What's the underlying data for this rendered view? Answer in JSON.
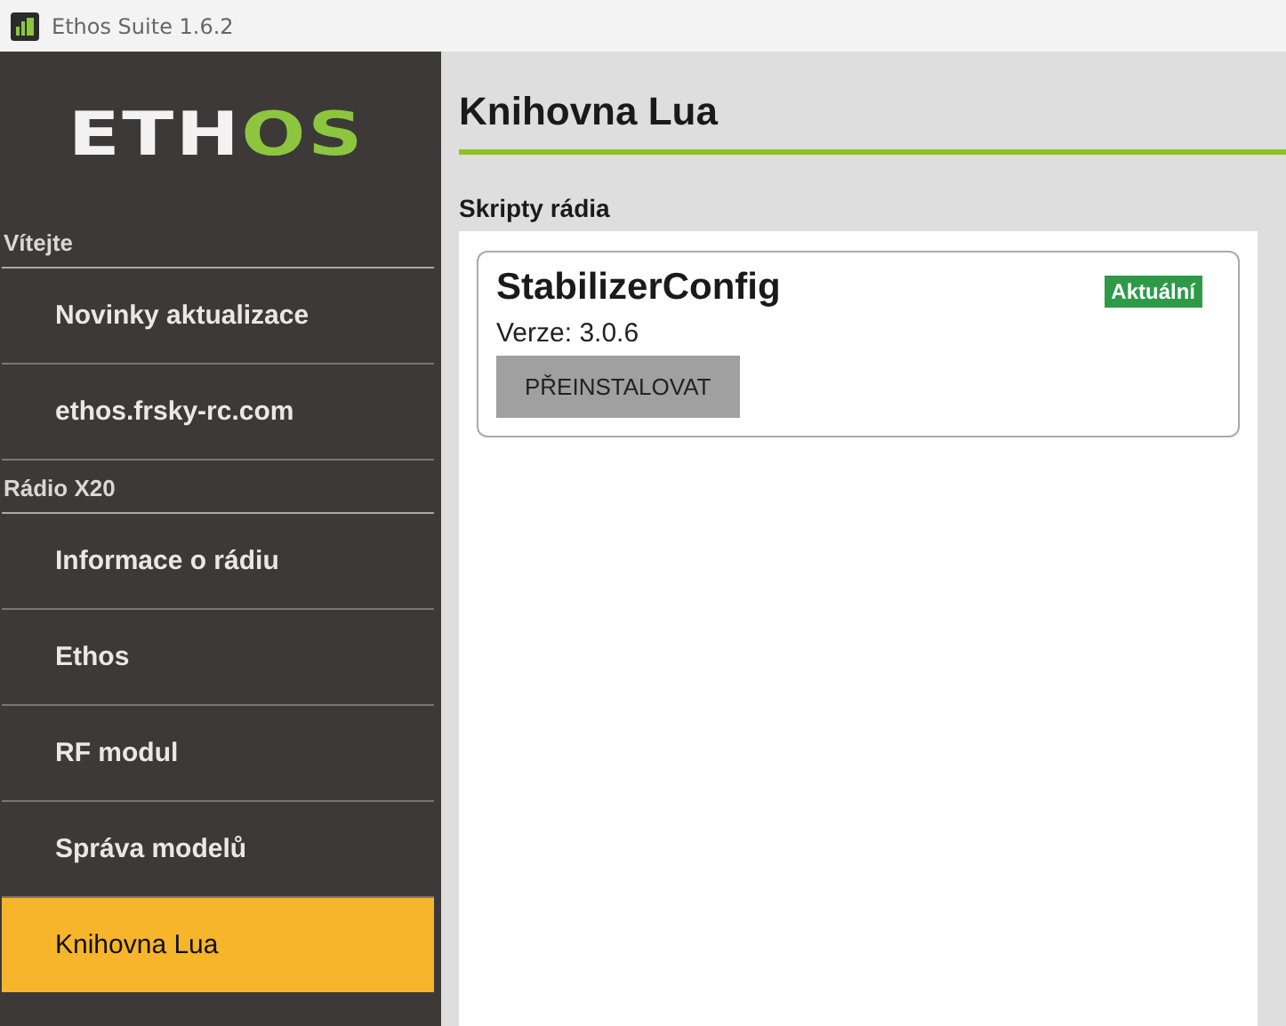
{
  "window": {
    "title": "Ethos Suite 1.6.2"
  },
  "logo": [
    {
      "text": "ETH",
      "color": "#f2f2f2"
    },
    {
      "text": "OS",
      "color": "#8cc63f"
    }
  ],
  "sidebar": {
    "sections": [
      {
        "title": "Vítejte",
        "items": [
          {
            "label": "Novinky aktualizace",
            "selected": false
          },
          {
            "label": "ethos.frsky-rc.com",
            "selected": false
          }
        ]
      },
      {
        "title": "Rádio X20",
        "items": [
          {
            "label": "Informace o rádiu",
            "selected": false
          },
          {
            "label": "Ethos",
            "selected": false
          },
          {
            "label": "RF modul",
            "selected": false
          },
          {
            "label": "Správa modelů",
            "selected": false
          },
          {
            "label": "Knihovna Lua",
            "selected": true
          }
        ]
      }
    ]
  },
  "page": {
    "title": "Knihovna Lua",
    "section": "Skripty rádia",
    "scripts": [
      {
        "name": "StabilizerConfig",
        "status": "Aktuální",
        "version": "Verze: 3.0.6",
        "button": "PŘEINSTALOVAT"
      }
    ]
  }
}
